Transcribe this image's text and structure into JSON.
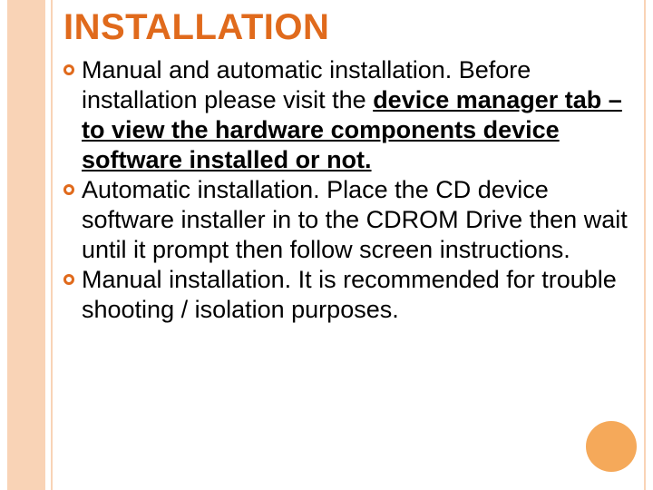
{
  "title": "INSTALLATION",
  "bullets": [
    {
      "lead": "Manual",
      "plain": " and automatic installation. Before installation please visit the ",
      "emph": "device manager tab – to view the hardware components device software installed or not."
    },
    {
      "lead": "Automatic",
      "plain": " installation. Place the CD device software installer in to the CDROM Drive then wait until it prompt then follow screen instructions.",
      "emph": ""
    },
    {
      "lead": "Manual",
      "plain": " installation. It is recommended for trouble shooting / isolation purposes.",
      "emph": ""
    }
  ],
  "colors": {
    "accent": "#e06a1c",
    "band": "#f9d3b6",
    "circle": "#f5a95a"
  }
}
